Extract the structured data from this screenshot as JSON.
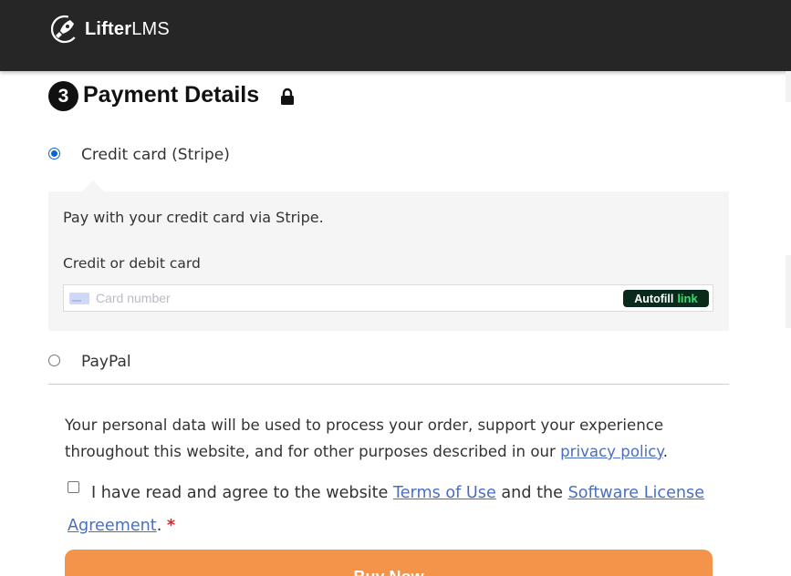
{
  "header": {
    "logo_text_bold": "Lifter",
    "logo_text_light": "LMS"
  },
  "payment": {
    "step_number": "3",
    "title": "Payment Details",
    "lock_icon": "lock-icon",
    "options": [
      {
        "label": "Credit card (Stripe)",
        "selected": true
      },
      {
        "label": "PayPal",
        "selected": false
      }
    ],
    "stripe": {
      "description": "Pay with your credit card via Stripe.",
      "card_label": "Credit or debit card",
      "card_placeholder": "Card number",
      "autofill_label": "Autofill",
      "link_label": "link"
    }
  },
  "privacy": {
    "text_before": "Your personal data will be used to process your order, support your experience throughout this website, and for other purposes described in our ",
    "link": "privacy policy",
    "text_after": "."
  },
  "terms": {
    "text_before": "I have read and agree to the website ",
    "link1": "Terms of Use",
    "text_middle": " and the ",
    "link2": "Software License Agreement",
    "text_after": ".",
    "required_mark": "*"
  },
  "buy_button": "Buy Now",
  "colors": {
    "header_bg": "#262626",
    "accent_button": "#f4944b",
    "link": "#4a6fc2",
    "radio_selected": "#0b63d6",
    "required": "#d8262c"
  }
}
